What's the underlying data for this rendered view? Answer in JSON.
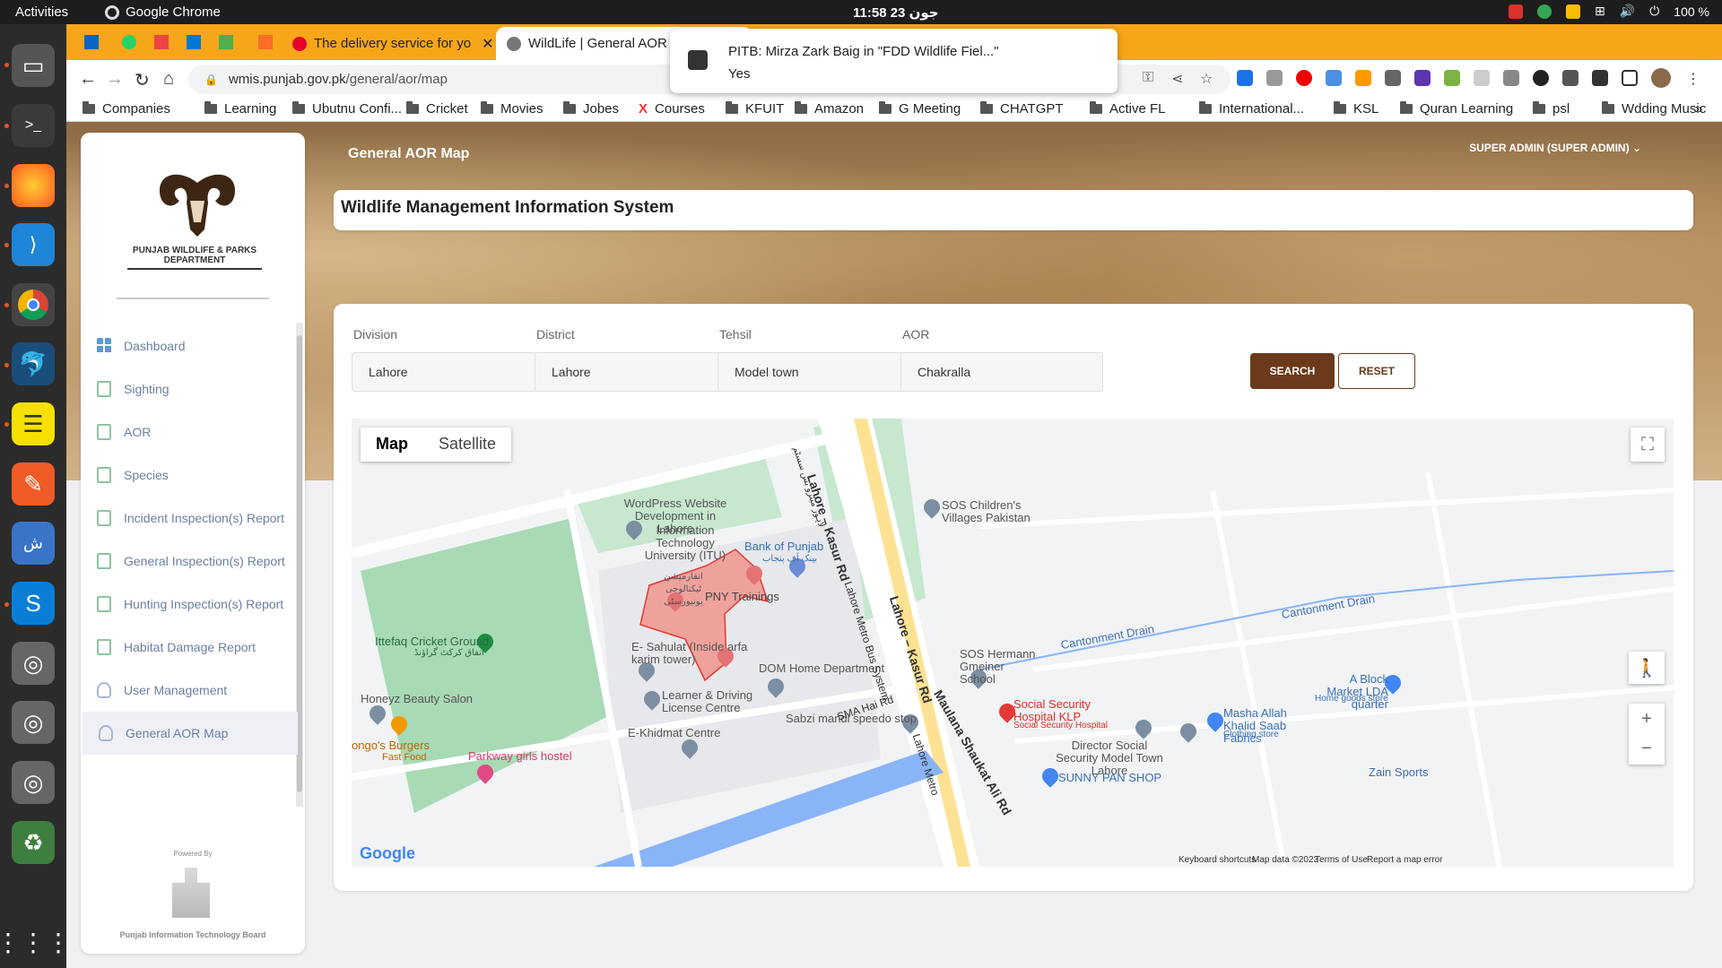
{
  "os": {
    "activities": "Activities",
    "app_name": "Google Chrome",
    "clock": "11:58  23 جون",
    "battery": "100 %"
  },
  "browser": {
    "tabs": [
      {
        "label": "The delivery service for yo"
      },
      {
        "label": "WildLife | General AOR"
      }
    ],
    "url_domain": "wmis.punjab.gov.pk",
    "url_path": "/general/aor/map",
    "bookmarks": [
      "Companies",
      "Learning",
      "Ubutnu Confi...",
      "Cricket",
      "Movies",
      "Jobes",
      "Courses",
      "KFUIT",
      "Amazon",
      "G Meeting",
      "CHATGPT",
      "Active FL",
      "International...",
      "KSL",
      "Quran Learning",
      "psl",
      "Wdding Music"
    ]
  },
  "notification": {
    "title": "PITB: Mirza Zark Baig in \"FDD Wildlife Fiel...\"",
    "body": "Yes"
  },
  "header": {
    "page_title": "General AOR Map",
    "user": "SUPER ADMIN (SUPER ADMIN)",
    "app_title": "Wildlife Management Information System"
  },
  "sidebar": {
    "logo_text": "PUNJAB WILDLIFE & PARKS DEPARTMENT",
    "items": [
      {
        "label": "Dashboard"
      },
      {
        "label": "Sighting"
      },
      {
        "label": "AOR"
      },
      {
        "label": "Species"
      },
      {
        "label": "Incident Inspection(s) Report"
      },
      {
        "label": "General Inspection(s) Report"
      },
      {
        "label": "Hunting Inspection(s) Report"
      },
      {
        "label": "Habitat Damage Report"
      },
      {
        "label": "User Management"
      },
      {
        "label": "General AOR Map"
      }
    ],
    "powered_by": "Powered By",
    "pitb": "Punjab Information Technology Board"
  },
  "filters": {
    "division": {
      "label": "Division",
      "value": "Lahore"
    },
    "district": {
      "label": "District",
      "value": "Lahore"
    },
    "tehsil": {
      "label": "Tehsil",
      "value": "Model town"
    },
    "aor": {
      "label": "AOR",
      "value": "Chakralla"
    },
    "search": "SEARCH",
    "reset": "RESET"
  },
  "map": {
    "type_map": "Map",
    "type_satellite": "Satellite",
    "places": {
      "wordpress": "WordPress Website Development in Lahore",
      "itu": "Information Technology University (ITU)",
      "itu_ur": "انفارمیشن ٹیکنالوجی یونیورسٹی",
      "bop": "Bank of Punjab",
      "bop_ur": "بینک آف پنجاب",
      "pny": "PNY Trainings",
      "sahulat": "E- Sahulat (Inside arfa karim tower)",
      "ittefaq": "Ittefaq Cricket Ground",
      "ittefaq_ur": "اتفاق کرکٹ گراؤنڈ",
      "honeyz": "Honeyz Beauty Salon",
      "bongos": "ongo's Burgers",
      "fastfood": "Fast Food",
      "parkway": "Parkway girls hostel",
      "learner": "Learner & Driving License Centre",
      "dom": "DOM Home Department",
      "ekhidmat": "E-Khidmat Centre",
      "sabzi": "Sabzi mandi speedo stop",
      "sos_children": "SOS Children's Villages Pakistan",
      "sos_hermann": "SOS Hermann Gmeiner School",
      "social": "Social Security Hospital KLP",
      "social_sub": "Social Security Hospital",
      "director": "Director Social Security Model Town Lahore",
      "sunny": "SUNNY PAN SHOP",
      "masha": "Masha Allah Khalid Saab Fabrics",
      "clothing": "Clothing store",
      "ablock": "A Block Market LDA quarter",
      "homegoods": "Home goods store",
      "zain": "Zain Sports"
    },
    "roads": {
      "kasur1": "Lahore – Kasur Rd",
      "kasur2": "Lahore – Kasur Rd",
      "metro": "Lahore Metro Bus System",
      "metro2": "Lahore Metro",
      "maulana": "Maulana Shaukat Ali Rd",
      "sma": "SMA Hai Rd",
      "cantt1": "Cantonment Drain",
      "cantt2": "Cantonment Drain",
      "urdu_road": "لاہور میٹرو بس سسٹم"
    },
    "attribution": {
      "google": "Google",
      "shortcuts": "Keyboard shortcuts",
      "data": "Map data ©2023",
      "terms": "Terms of Use",
      "report": "Report a map error"
    }
  }
}
